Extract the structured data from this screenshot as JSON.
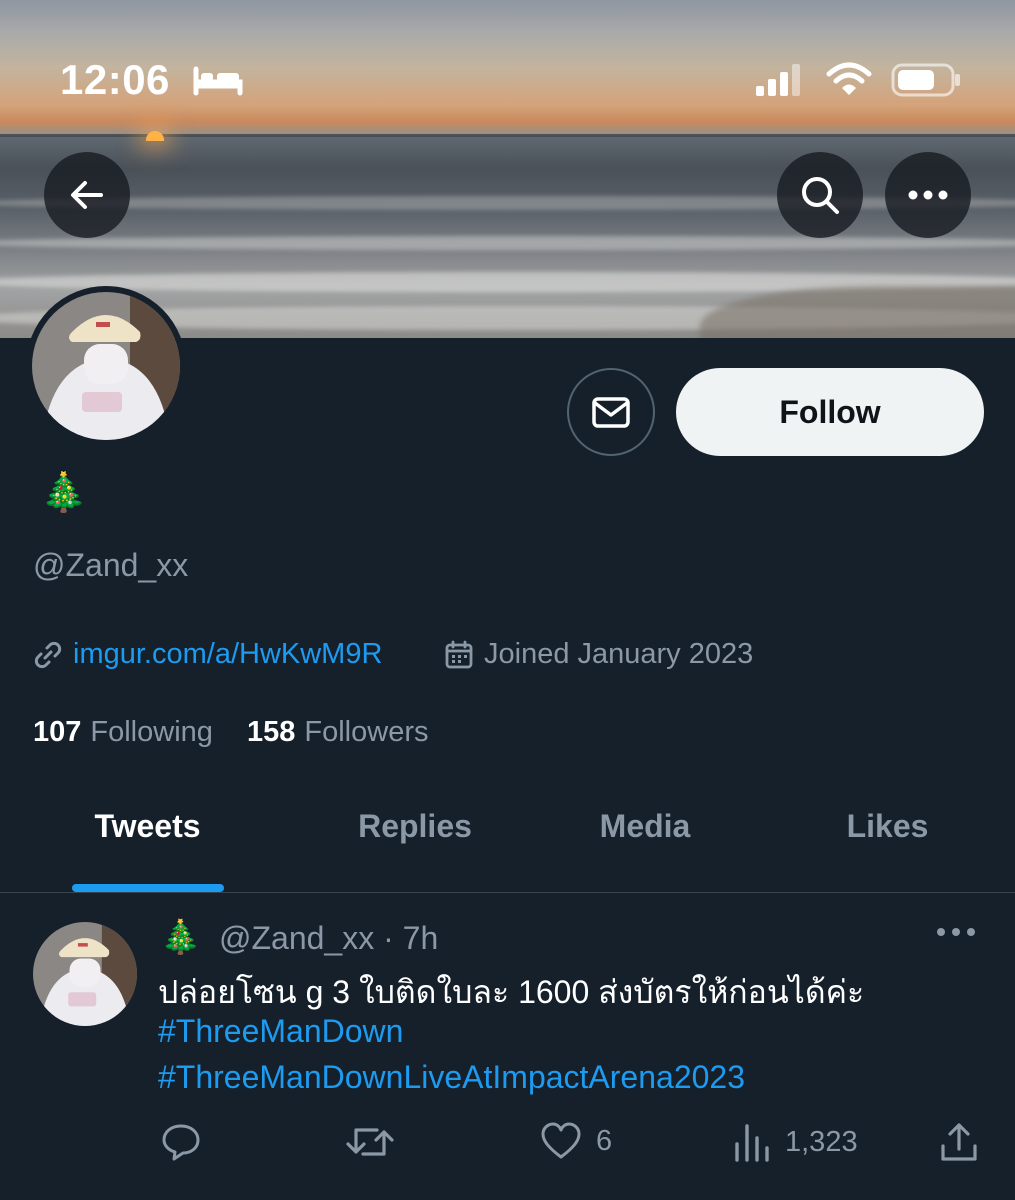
{
  "status_bar": {
    "time": "12:06"
  },
  "profile": {
    "display_name": "🎄",
    "handle": "@Zand_xx",
    "link": "imgur.com/a/HwKwM9R",
    "joined": "Joined January 2023",
    "following_count": "107",
    "following_label": "Following",
    "followers_count": "158",
    "followers_label": "Followers",
    "follow_label": "Follow"
  },
  "tabs": [
    {
      "label": "Tweets",
      "active": true
    },
    {
      "label": "Replies",
      "active": false
    },
    {
      "label": "Media",
      "active": false
    },
    {
      "label": "Likes",
      "active": false
    }
  ],
  "tweet": {
    "name": "🎄",
    "handle_time": "@Zand_xx · 7h",
    "text": "ปล่อยโซน g 3 ใบติดใบละ 1600 ส่งบัตรให้ก่อนได้ค่ะ",
    "hashtags": [
      "#ThreeManDown",
      "#ThreeManDownLiveAtImpactArena2023"
    ],
    "likes": "6",
    "views": "1,323"
  },
  "icons": {
    "back": "arrow-left-icon",
    "search": "search-icon",
    "more": "more-horizontal-icon",
    "message": "mail-icon",
    "link": "link-icon",
    "calendar": "calendar-icon",
    "reply": "reply-icon",
    "retweet": "retweet-icon",
    "like": "heart-icon",
    "views": "views-icon",
    "share": "share-icon"
  },
  "colors": {
    "background": "#15202b",
    "accent": "#1d9bf0",
    "muted": "#8b98a5",
    "follow_button": "#eff3f4"
  }
}
